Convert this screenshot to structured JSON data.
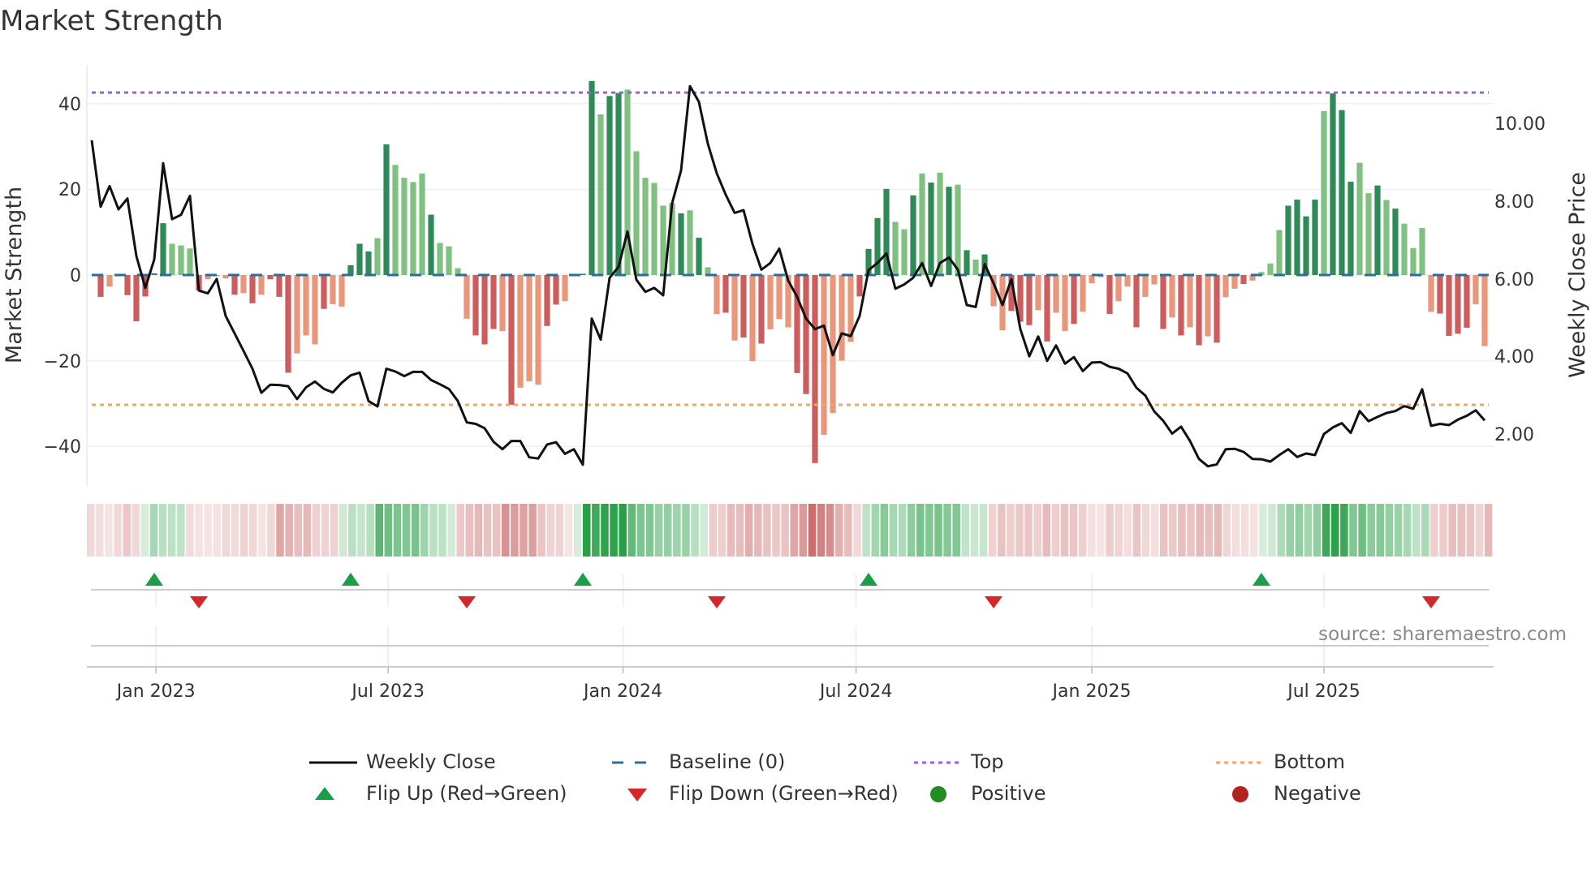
{
  "title": "Market Strength",
  "source": "source: sharemaestro.com",
  "legend": {
    "weekly_close": "Weekly Close",
    "baseline": "Baseline (0)",
    "top": "Top",
    "bottom": "Bottom",
    "flip_up": "Flip Up (Red→Green)",
    "flip_down": "Flip Down (Green→Red)",
    "positive": "Positive",
    "negative": "Negative"
  },
  "colors": {
    "green_dark": "#2e8b57",
    "green_light": "#80c080",
    "red_dark": "#cd5c5c",
    "red_light": "#e9967a",
    "top": "#9b5fd6",
    "bottom": "#f4a460",
    "baseline": "#2a6f9b",
    "flip_up": "#1a9e4a",
    "flip_down": "#d62728",
    "positive": "#228b22",
    "negative": "#b22222",
    "price": "#111111"
  },
  "chart_data": {
    "type": "bar",
    "title": "Market Strength",
    "ylabel": "Market Strength",
    "y2label": "Weekly Close Price",
    "ylim": [
      -48,
      50
    ],
    "y2lim": [
      0.55,
      11.2
    ],
    "yticks": [
      "40",
      "20",
      "0",
      "−20",
      "−40"
    ],
    "ytick_values": [
      40,
      20,
      0,
      -20,
      -40
    ],
    "y2ticks": [
      "10.00",
      "8.00",
      "6.00",
      "4.00",
      "2.00"
    ],
    "y2tick_values": [
      10,
      8,
      6,
      4,
      2
    ],
    "xticks": [
      {
        "label": "Jan 2023",
        "week": 7.2
      },
      {
        "label": "Jul 2023",
        "week": 33.2
      },
      {
        "label": "Jan 2024",
        "week": 59.5
      },
      {
        "label": "Jul 2024",
        "week": 85.6
      },
      {
        "label": "Jan 2025",
        "week": 112
      },
      {
        "label": "Jul 2025",
        "week": 138
      }
    ],
    "top_level": 42.6,
    "bottom_level": -30.3,
    "baseline": 0,
    "strength": [
      -5.1,
      -2.7,
      -0.3,
      -4.7,
      -10.8,
      -5,
      0.4,
      12.1,
      7.3,
      6.9,
      6.2,
      -3.6,
      -1,
      -0.3,
      -0.8,
      -4.6,
      -4.2,
      -6.6,
      -4.6,
      -1,
      -5.1,
      -22.8,
      -18.3,
      -14.1,
      -16.2,
      -7.9,
      -6.8,
      -7.4,
      2.3,
      7.3,
      5.5,
      8.6,
      30.5,
      25.7,
      22.7,
      21.7,
      23.7,
      14.1,
      7.5,
      6.7,
      1.6,
      -10.2,
      -14.1,
      -16.2,
      -12.6,
      -13.1,
      -30.3,
      -26.3,
      -24.8,
      -25.6,
      -11.9,
      -6.9,
      -6.1,
      -0.3,
      0.3,
      45.3,
      37.5,
      41.8,
      42.5,
      43.3,
      28.9,
      22.7,
      21.5,
      16.2,
      16.8,
      14.4,
      15.1,
      8.7,
      1.8,
      -9.1,
      -8.8,
      -15.3,
      -14.6,
      -20.1,
      -16,
      -12.7,
      -10.3,
      -12.2,
      -22.9,
      -27.8,
      -43.9,
      -37.3,
      -32.2,
      -20,
      -15.6,
      -5,
      6.1,
      13.3,
      20.1,
      12.4,
      10.7,
      18.6,
      23.7,
      21.6,
      23.9,
      20.6,
      21.1,
      5.8,
      3.6,
      4.8,
      -7.3,
      -12.9,
      -8.4,
      -10.9,
      -11.7,
      -8.2,
      -15.5,
      -8.8,
      -13.1,
      -11.4,
      -8.6,
      -1.9,
      -0.5,
      -9.1,
      -6.1,
      -2.7,
      -12.2,
      -5.1,
      -2.2,
      -12.6,
      -9.9,
      -14.1,
      -12.2,
      -16.4,
      -14.3,
      -15.8,
      -5.2,
      -3.2,
      -2.1,
      -1.3,
      0.7,
      2.7,
      10.5,
      16.2,
      17.6,
      13.7,
      17.6,
      38.3,
      42.4,
      38.5,
      21.8,
      26.2,
      19.1,
      20.9,
      17.5,
      15.5,
      12,
      6.3,
      11,
      -8.6,
      -9,
      -14.2,
      -13.7,
      -12.3,
      -6.8,
      -16.6
    ],
    "strength_rising": "dlldddddllldllldldldddllldlldddldlllldlllldddldlllddllddlddl llllldldlldldldllldddllllddddlldldldldldlldddldlldllldlldlldldldldlldllllddddldddlldldllllddddlldld",
    "weekly_close": [
      9.56,
      7.85,
      8.38,
      7.78,
      8.06,
      6.58,
      5.76,
      6.49,
      8.97,
      7.53,
      7.64,
      8.13,
      5.69,
      5.62,
      5.99,
      5.04,
      4.59,
      4.14,
      3.68,
      3.06,
      3.27,
      3.26,
      3.23,
      2.9,
      3.2,
      3.35,
      3.16,
      3.07,
      3.32,
      3.51,
      3.58,
      2.85,
      2.71,
      3.68,
      3.61,
      3.49,
      3.6,
      3.6,
      3.39,
      3.28,
      3.16,
      2.85,
      2.3,
      2.26,
      2.15,
      1.8,
      1.61,
      1.82,
      1.82,
      1.4,
      1.37,
      1.73,
      1.79,
      1.49,
      1.61,
      1.21,
      4.97,
      4.43,
      6.02,
      6.3,
      7.21,
      5.97,
      5.66,
      5.76,
      5.57,
      7.94,
      8.78,
      10.95,
      10.55,
      9.47,
      8.71,
      8.16,
      7.69,
      7.76,
      6.89,
      6.23,
      6.4,
      6.77,
      5.95,
      5.53,
      4.97,
      4.7,
      4.79,
      4.03,
      4.59,
      4.52,
      5.04,
      6.22,
      6.4,
      6.65,
      5.74,
      5.85,
      6.02,
      6.4,
      5.81,
      6.4,
      6.54,
      6.23,
      5.32,
      5.27,
      6.37,
      5.88,
      5.32,
      5.99,
      4.7,
      4.0,
      4.51,
      3.88,
      4.28,
      3.81,
      3.98,
      3.62,
      3.84,
      3.85,
      3.73,
      3.68,
      3.56,
      3.19,
      2.99,
      2.58,
      2.34,
      2.01,
      2.19,
      1.82,
      1.36,
      1.17,
      1.22,
      1.61,
      1.62,
      1.54,
      1.36,
      1.35,
      1.29,
      1.46,
      1.61,
      1.41,
      1.5,
      1.46,
      2.0,
      2.17,
      2.28,
      2.03,
      2.59,
      2.33,
      2.44,
      2.54,
      2.59,
      2.72,
      2.65,
      3.15,
      2.21,
      2.26,
      2.23,
      2.37,
      2.47,
      2.61,
      2.35
    ],
    "weekly_close_start_week": 0,
    "flip_up_weeks": [
      7,
      29,
      55,
      87,
      131
    ],
    "flip_down_weeks": [
      12,
      42,
      70,
      101,
      150
    ],
    "grid": true,
    "legend_position": "bottom"
  }
}
